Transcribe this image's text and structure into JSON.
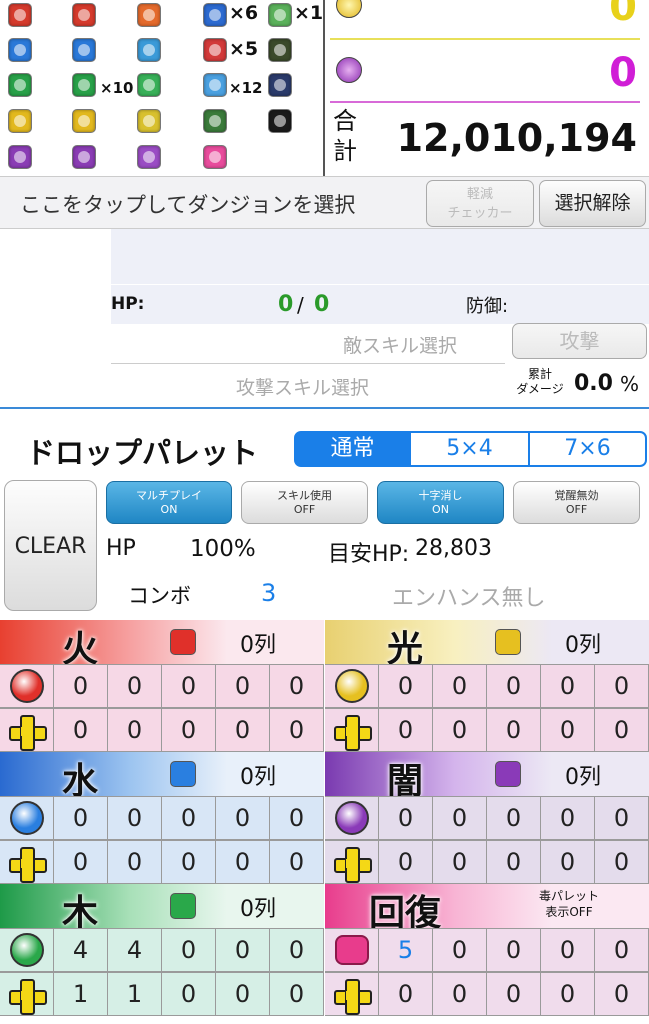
{
  "awakenings": {
    "col1_mult": "",
    "col2": {
      "row_green_mult": "×10"
    },
    "col3": {
      "row_blue_mult": "×6",
      "row_red_mult": "×5",
      "row_hand_mult": "×12"
    },
    "col4": {
      "row_top_mult": "×1"
    }
  },
  "summary": {
    "light_value": "0",
    "dark_value": "0",
    "total_label": "合\n計",
    "total_label_top": "合",
    "total_label_bottom": "計",
    "total_value": "12,010,194"
  },
  "dungeon": {
    "select_text": "ここをタップしてダンジョンを選択",
    "checker_label_1": "軽減",
    "checker_label_2": "チェッカー",
    "deselect_label": "選択解除"
  },
  "enemy": {
    "hp_label": "HP:",
    "hp_current": "0",
    "hp_sep": "/",
    "hp_max": "0",
    "defense_label": "防御:",
    "enemy_skill_placeholder": "敵スキル選択",
    "attack_label": "攻撃",
    "attack_skill_placeholder": "攻撃スキル選択",
    "cumulative_label_1": "累計",
    "cumulative_label_2": "ダメージ",
    "cumulative_value": "0.0",
    "cumulative_unit": "%"
  },
  "palette": {
    "title": "ドロップパレット",
    "tabs": [
      {
        "label": "通常",
        "active": true
      },
      {
        "label": "5×4",
        "active": false
      },
      {
        "label": "7×6",
        "active": false
      }
    ],
    "clear_label": "CLEAR",
    "toggles": [
      {
        "line1": "マルチプレイ",
        "line2": "ON",
        "state": "on"
      },
      {
        "line1": "スキル使用",
        "line2": "OFF",
        "state": "off"
      },
      {
        "line1": "十字消し",
        "line2": "ON",
        "state": "on"
      },
      {
        "line1": "覚醒無効",
        "line2": "OFF",
        "state": "off"
      }
    ],
    "hp_label": "HP",
    "hp_value": "100%",
    "target_hp_label": "目安HP:",
    "target_hp_value": "28,803",
    "combo_label": "コンボ",
    "combo_value": "3",
    "enhance_text": "エンハンス無し",
    "poison_palette_1": "毒パレット",
    "poison_palette_2": "表示OFF",
    "fire": {
      "label": "火",
      "count": "0列",
      "row": [
        "0",
        "0",
        "0",
        "0",
        "0"
      ],
      "plus": [
        "0",
        "0",
        "0",
        "0",
        "0"
      ],
      "color": "#e0302a"
    },
    "light": {
      "label": "光",
      "count": "0列",
      "row": [
        "0",
        "0",
        "0",
        "0",
        "0"
      ],
      "plus": [
        "0",
        "0",
        "0",
        "0",
        "0"
      ],
      "color": "#e6c020"
    },
    "water": {
      "label": "水",
      "count": "0列",
      "row": [
        "0",
        "0",
        "0",
        "0",
        "0"
      ],
      "plus": [
        "0",
        "0",
        "0",
        "0",
        "0"
      ],
      "color": "#2a7fe0"
    },
    "dark": {
      "label": "闇",
      "count": "0列",
      "row": [
        "0",
        "0",
        "0",
        "0",
        "0"
      ],
      "plus": [
        "0",
        "0",
        "0",
        "0",
        "0"
      ],
      "color": "#8a3ab8"
    },
    "wood": {
      "label": "木",
      "count": "0列",
      "row": [
        "4",
        "4",
        "0",
        "0",
        "0"
      ],
      "plus": [
        "1",
        "1",
        "0",
        "0",
        "0"
      ],
      "color": "#2aa84a"
    },
    "heal": {
      "label": "回復",
      "row": [
        "5",
        "0",
        "0",
        "0",
        "0"
      ],
      "plus": [
        "0",
        "0",
        "0",
        "0",
        "0"
      ],
      "color": "#e83c8c"
    }
  }
}
